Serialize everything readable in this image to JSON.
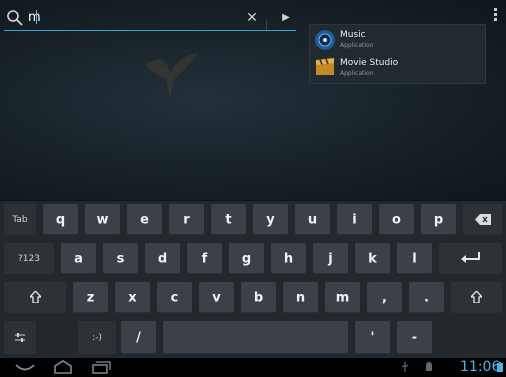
{
  "search": {
    "query": "m"
  },
  "suggestions": [
    {
      "title": "Music",
      "subtitle": "Application",
      "icon": "music-icon"
    },
    {
      "title": "Movie Studio",
      "subtitle": "Application",
      "icon": "movie-studio-icon"
    }
  ],
  "keyboard": {
    "row1": [
      "Tab",
      "q",
      "w",
      "e",
      "r",
      "t",
      "y",
      "u",
      "i",
      "o",
      "p",
      "backspace-icon"
    ],
    "row2": [
      "?123",
      "a",
      "s",
      "d",
      "f",
      "g",
      "h",
      "j",
      "k",
      "l",
      "enter-icon"
    ],
    "row3": [
      "shift-icon",
      "z",
      "x",
      "c",
      "v",
      "b",
      "n",
      "m",
      ",",
      ".",
      "shift-icon"
    ],
    "row4": [
      "settings-icon",
      ":-)",
      "/",
      "",
      "'",
      "-"
    ]
  },
  "status_bar": {
    "clock": "11:06"
  },
  "colors": {
    "accent": "#3aa0d8",
    "clock": "#47b6ec",
    "key": "#3b4146",
    "keyboard_bg": "#23282c"
  }
}
